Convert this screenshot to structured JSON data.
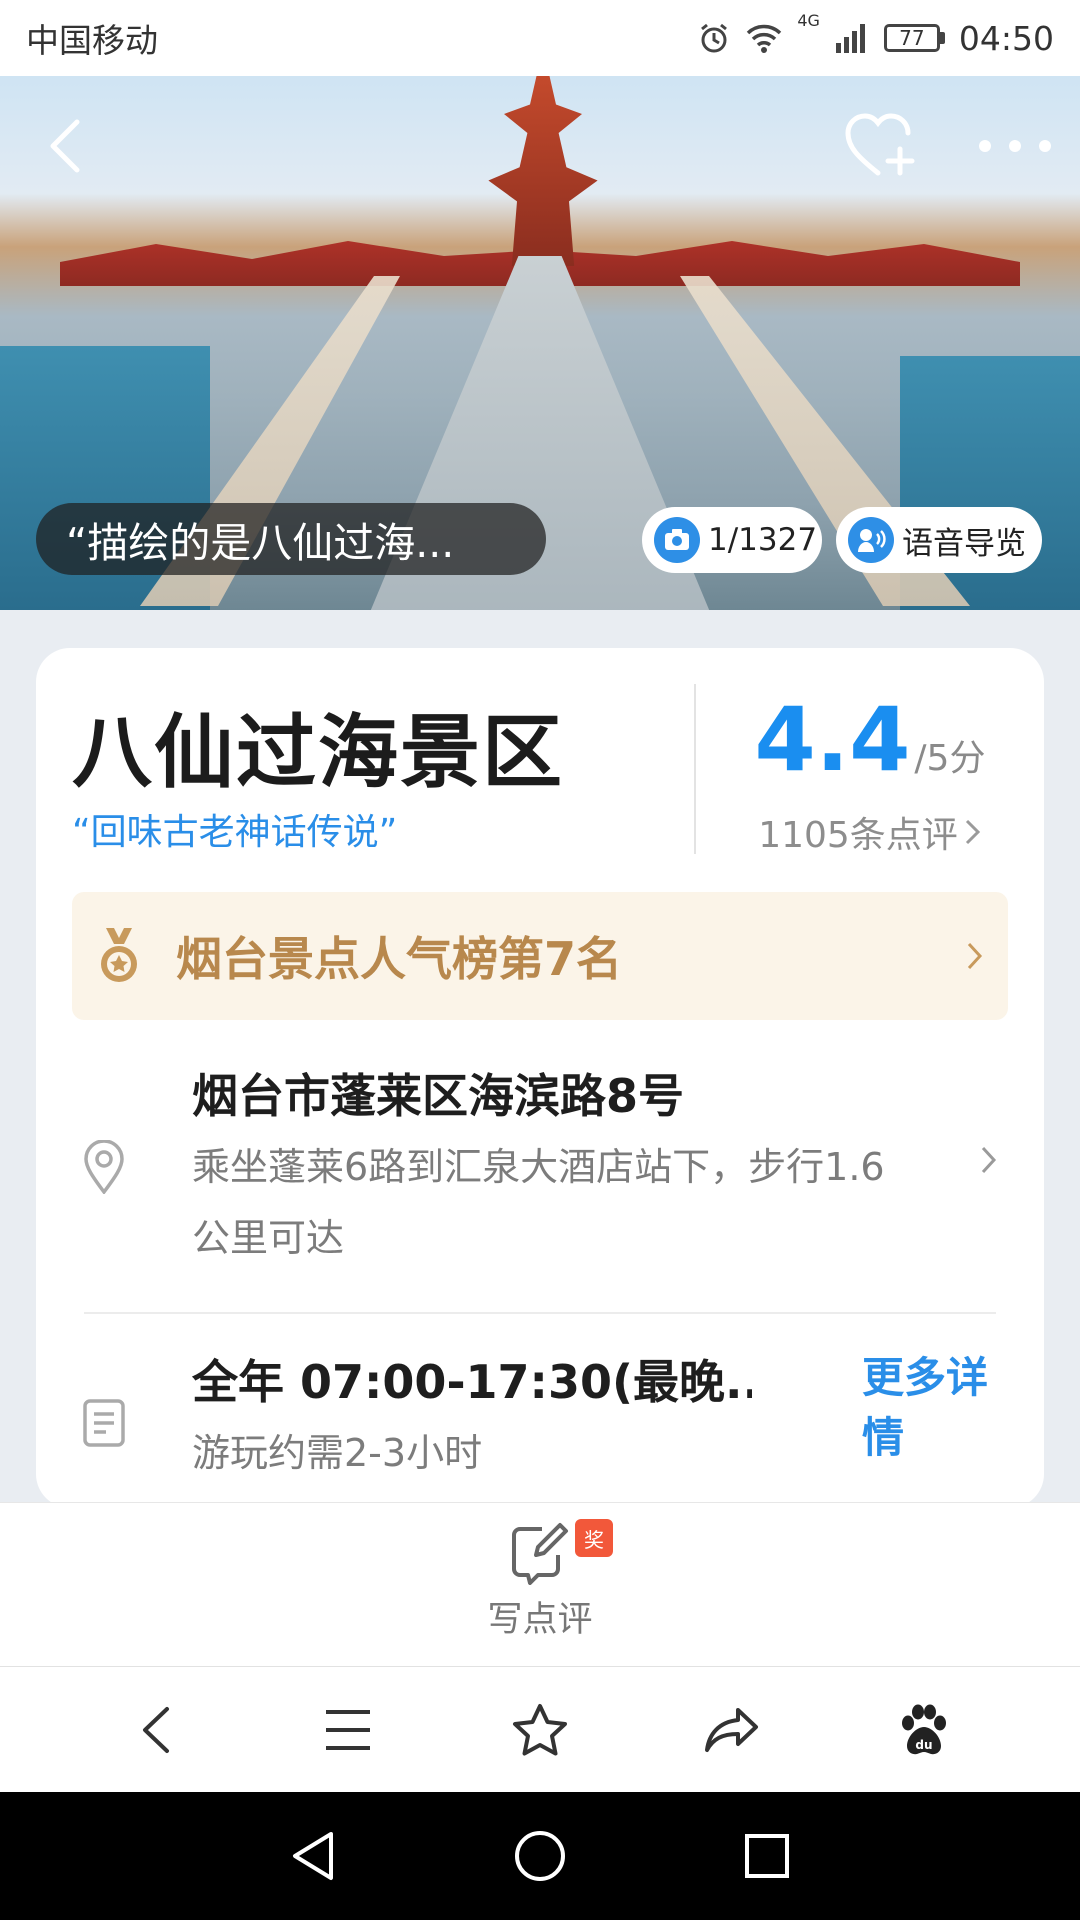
{
  "status_bar": {
    "carrier": "中国移动",
    "network": "4G",
    "battery": "77",
    "time": "04:50"
  },
  "hero": {
    "quote": "“描绘的是八仙过海...",
    "photo_count": "1/1327",
    "audio_guide": "语音导览"
  },
  "spot": {
    "name": "八仙过海景区",
    "slogan": "“回味古老神话传说”",
    "score": "4.4",
    "score_unit": "/5分",
    "reviews": "1105条点评"
  },
  "rank": {
    "text": "烟台景点人气榜第7名"
  },
  "address": {
    "title": "烟台市蓬莱区海滨路8号",
    "transit": "乘坐蓬莱6路到汇泉大酒店站下，步行1.6公里可达"
  },
  "hours": {
    "title": "全年 07:00-17:30(最晚...",
    "duration": "游玩约需2-3小时",
    "more_label": "更多详情"
  },
  "review_bar": {
    "write_label": "写点评",
    "badge": "奖"
  },
  "colors": {
    "accent": "#1a8ef0",
    "rank_text": "#b8884d",
    "rank_bg": "#fbf4e8",
    "badge": "#f2583a"
  },
  "icons": [
    "back-icon",
    "heart-plus-icon",
    "more-icon",
    "camera-icon",
    "speaker-icon",
    "medal-icon",
    "location-pin-icon",
    "document-icon",
    "chevron-right-icon",
    "edit-icon",
    "menu-icon",
    "star-icon",
    "share-icon",
    "baidu-paw-icon",
    "nav-back-icon",
    "nav-home-icon",
    "nav-recents-icon"
  ]
}
